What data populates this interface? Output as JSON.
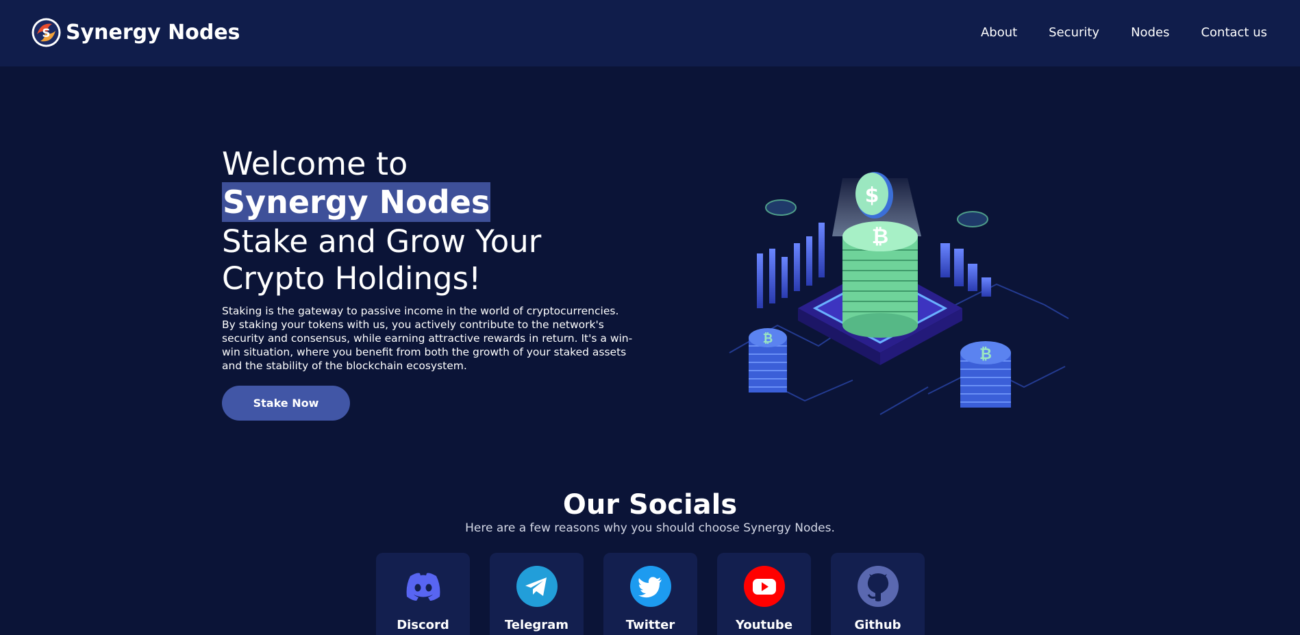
{
  "header": {
    "brand": "Synergy Nodes",
    "nav": [
      "About",
      "Security",
      "Nodes",
      "Contact us"
    ]
  },
  "hero": {
    "welcome": "Welcome to",
    "brand": "Synergy Nodes",
    "tagline": "Stake and Grow Your Crypto Holdings!",
    "description": "Staking is the gateway to passive income in the world of cryptocurrencies. By staking your tokens with us, you actively contribute to the network's security and consensus, while earning attractive rewards in return. It's a win-win situation, where you benefit from both the growth of your staked assets and the stability of the blockchain ecosystem.",
    "cta": "Stake Now"
  },
  "socials": {
    "title": "Our Socials",
    "subtitle": "Here are a few reasons why you should choose Synergy Nodes.",
    "items": [
      {
        "label": "Discord",
        "icon": "discord-icon",
        "color": "#5865f2"
      },
      {
        "label": "Telegram",
        "icon": "telegram-icon",
        "color": "#229ed9"
      },
      {
        "label": "Twitter",
        "icon": "twitter-icon",
        "color": "#1d9bf0"
      },
      {
        "label": "Youtube",
        "icon": "youtube-icon",
        "color": "#ff0000"
      },
      {
        "label": "Github",
        "icon": "github-icon",
        "color": "#5a68b0"
      }
    ]
  },
  "colors": {
    "background": "#0b1437",
    "header": "#101d4b",
    "accent": "#4156a6",
    "highlight": "#3e5099",
    "card": "#131f4f"
  }
}
